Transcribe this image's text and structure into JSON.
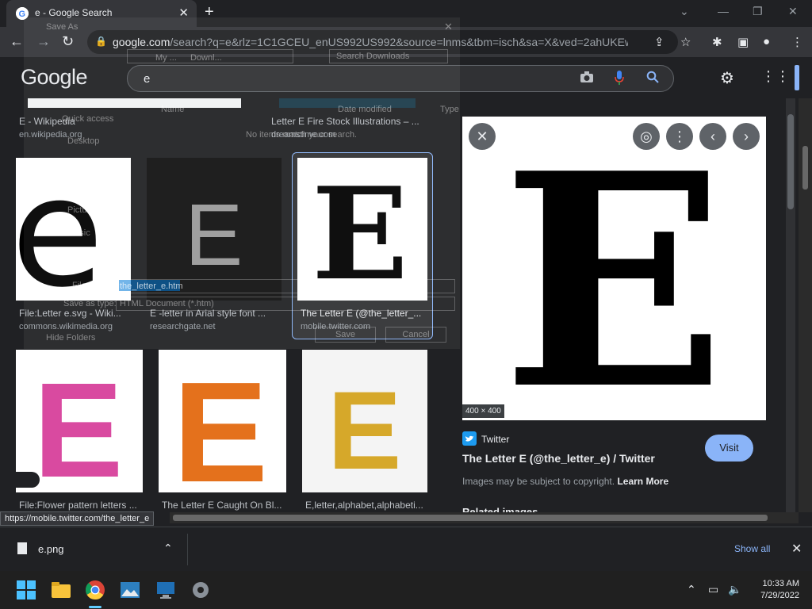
{
  "browser": {
    "tab_title": "e - Google Search",
    "new_tab_label": "+",
    "url_host": "google.com",
    "url_rest": "/search?q=e&rlz=1C1GCEU_enUS992US992&source=lnms&tbm=isch&sa=X&ved=2ahUKEwi3..."
  },
  "google": {
    "logo": "Google",
    "query": "e"
  },
  "results": [
    {
      "caption": "E - Wikipedia",
      "domain": "en.wikipedia.org"
    },
    {
      "caption": "Letter E Fire Stock Illustrations – ...",
      "domain": "dreamstime.com"
    },
    {
      "caption": "File:Letter e.svg - Wiki...",
      "domain": "commons.wikimedia.org"
    },
    {
      "caption": "E -letter in Arial style font ...",
      "domain": "researchgate.net"
    },
    {
      "caption": "The Letter E (@the_letter_...",
      "domain": "mobile.twitter.com"
    },
    {
      "caption": "File:Flower pattern letters ...",
      "domain": ""
    },
    {
      "caption": "The Letter E Caught On Bl...",
      "domain": ""
    },
    {
      "caption": "E,letter,alphabet,alphabeti...",
      "domain": ""
    }
  ],
  "preview": {
    "dims": "400 × 400",
    "source": "Twitter",
    "title": "The Letter E (@the_letter_e) / Twitter",
    "visit": "Visit",
    "copyright": "Images may be subject to copyright.",
    "learn_more": "Learn More",
    "related": "Related images"
  },
  "status_url": "https://mobile.twitter.com/the_letter_e",
  "download": {
    "filename": "e.png",
    "show_all": "Show all"
  },
  "save_dialog": {
    "title": "Save As",
    "path_my": "My ...",
    "path_downloads": "Downl...",
    "search_placeholder": "Search Downloads",
    "col_name": "Name",
    "col_date": "Date modified",
    "col_type": "Type",
    "empty_msg": "No items match your search.",
    "quick_access": "Quick access",
    "nav": [
      "Desktop",
      "Downloads",
      "Documents",
      "Pictures",
      "Music",
      "Videos"
    ],
    "file_name_label": "File name:",
    "file_name_value": "the_letter_e.htm",
    "save_type_label": "Save as type:",
    "save_type_value": "HTML Document (*.htm)",
    "hide_folders": "Hide Folders",
    "save": "Save",
    "cancel": "Cancel"
  },
  "clock": {
    "time": "10:33 AM",
    "date": "7/29/2022"
  },
  "colors": {
    "accent": "#8ab4f8",
    "page_bg": "#202124"
  }
}
